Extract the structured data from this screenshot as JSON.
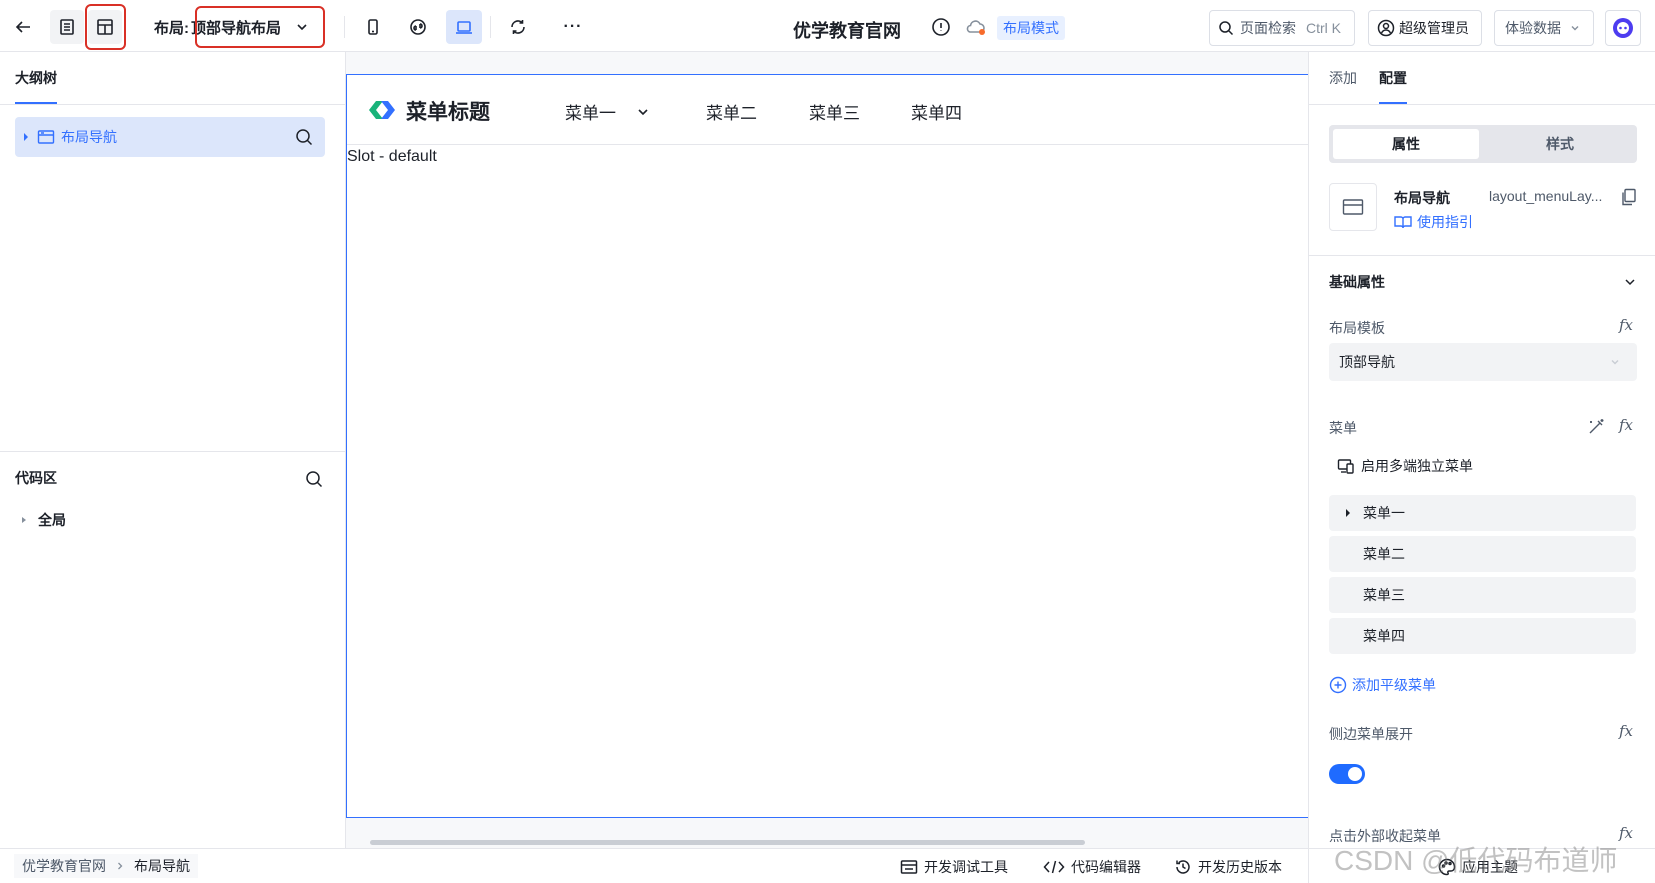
{
  "toolbar": {
    "layout_label": "布局:",
    "layout_value": "顶部导航布局",
    "app_title": "优学教育官网",
    "mode_badge": "布局模式",
    "search_label": "页面检索",
    "search_shortcut": "Ctrl K",
    "user_label": "超级管理员",
    "data_label": "体验数据",
    "more_label": "···"
  },
  "left_panel": {
    "outline_title": "大纲树",
    "outline_items": [
      {
        "label": "布局导航"
      }
    ],
    "code_title": "代码区",
    "code_items": [
      {
        "label": "全局"
      }
    ]
  },
  "canvas": {
    "brand_title": "菜单标题",
    "nav": [
      "菜单一",
      "菜单二",
      "菜单三",
      "菜单四"
    ],
    "slot_text": "Slot - default"
  },
  "right_panel": {
    "tabs": [
      "添加",
      "配置"
    ],
    "active_tab": "配置",
    "segments": [
      "属性",
      "样式"
    ],
    "component_name": "布局导航",
    "component_id": "layout_menuLay...",
    "guide_link": "使用指引",
    "section_title": "基础属性",
    "template_label": "布局模板",
    "template_value": "顶部导航",
    "menu_label": "菜单",
    "multi_menu_label": "启用多端独立菜单",
    "menu_items": [
      "菜单一",
      "菜单二",
      "菜单三",
      "菜单四"
    ],
    "add_menu": "添加平级菜单",
    "side_expand_label": "侧边菜单展开",
    "side_expand_on": true,
    "collapse_label": "点击外部收起菜单",
    "fx_label": "fx"
  },
  "bottom": {
    "breadcrumb": [
      "优学教育官网",
      "布局导航"
    ],
    "devtools": "开发调试工具",
    "code_editor": "代码编辑器",
    "history": "开发历史版本",
    "theme": "应用主题",
    "watermark": "CSDN @低代码布道师"
  },
  "colors": {
    "accent": "#3370ff",
    "highlight_red": "#d93026",
    "selected_bg": "#dce6fb"
  }
}
